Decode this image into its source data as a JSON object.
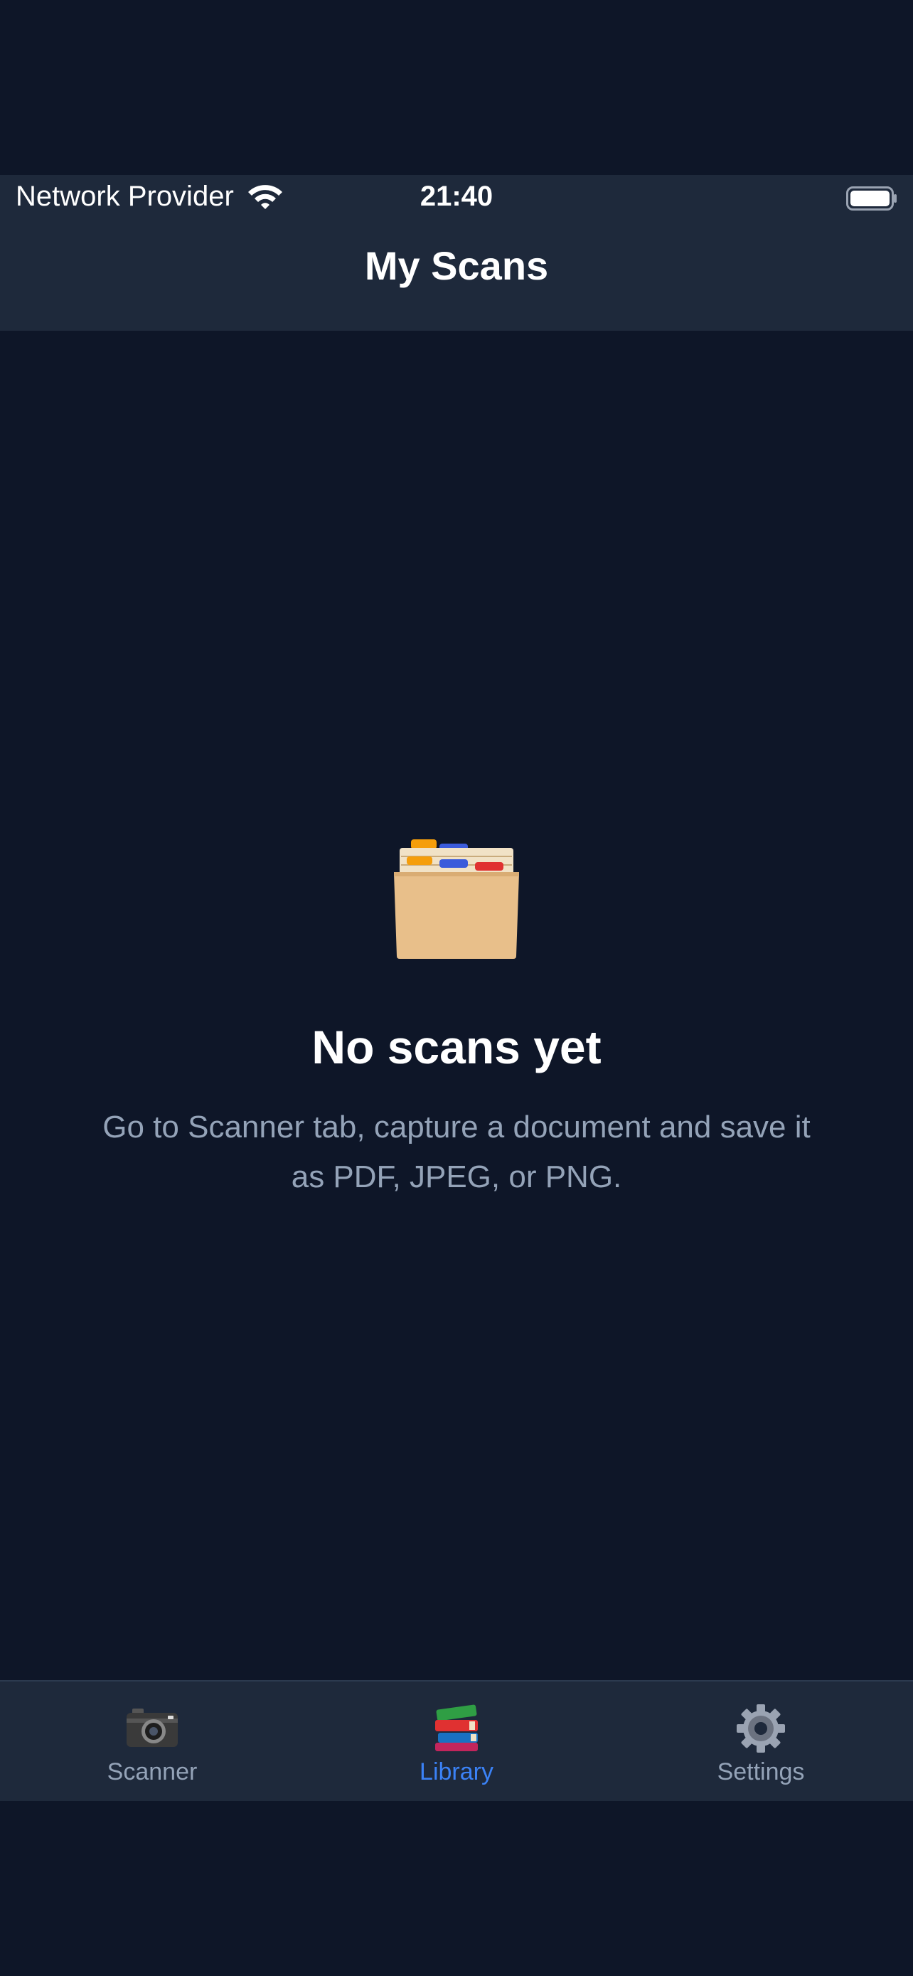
{
  "status_bar": {
    "carrier": "Network Provider",
    "time": "21:40"
  },
  "nav": {
    "title": "My Scans"
  },
  "empty_state": {
    "icon": "card-file-box-icon",
    "title": "No scans yet",
    "description": "Go to Scanner tab, capture a document and save it as PDF, JPEG, or PNG."
  },
  "tabs": [
    {
      "label": "Scanner",
      "icon": "camera-icon",
      "active": false
    },
    {
      "label": "Library",
      "icon": "books-icon",
      "active": true
    },
    {
      "label": "Settings",
      "icon": "gear-icon",
      "active": false
    }
  ],
  "colors": {
    "background": "#0e1628",
    "bar": "#1e293b",
    "accent": "#3b82f6",
    "muted_text": "#94a3b8"
  }
}
